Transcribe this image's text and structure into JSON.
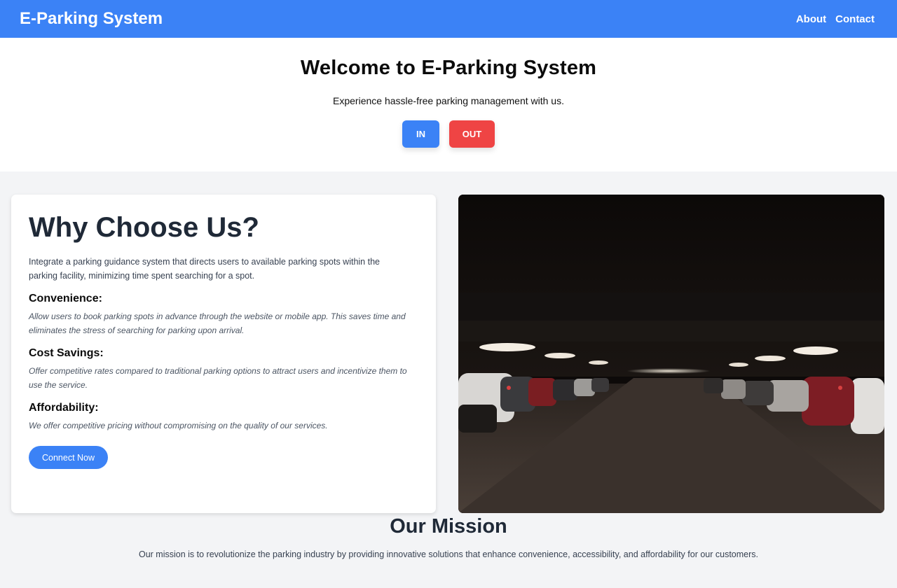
{
  "header": {
    "brand": "E-Parking System",
    "nav": [
      "About",
      "Contact"
    ]
  },
  "hero": {
    "title": "Welcome to E-Parking System",
    "subtitle": "Experience hassle-free parking management with us.",
    "in_label": "IN",
    "out_label": "OUT"
  },
  "why": {
    "title": "Why Choose Us?",
    "intro": "Integrate a parking guidance system that directs users to available parking spots within the parking facility, minimizing time spent searching for a spot.",
    "items": [
      {
        "heading": "Convenience:",
        "text": "Allow users to book parking spots in advance through the website or mobile app. This saves time and eliminates the stress of searching for parking upon arrival."
      },
      {
        "heading": "Cost Savings:",
        "text": "Offer competitive rates compared to traditional parking options to attract users and incentivize them to use the service."
      },
      {
        "heading": "Affordability:",
        "text": "We offer competitive pricing without compromising on the quality of our services."
      }
    ],
    "cta": "Connect Now"
  },
  "mission": {
    "title": "Our Mission",
    "text": "Our mission is to revolutionize the parking industry by providing innovative solutions that enhance convenience, accessibility, and affordability for our customers."
  },
  "colors": {
    "primary": "#3b82f6",
    "danger": "#ef4444"
  }
}
